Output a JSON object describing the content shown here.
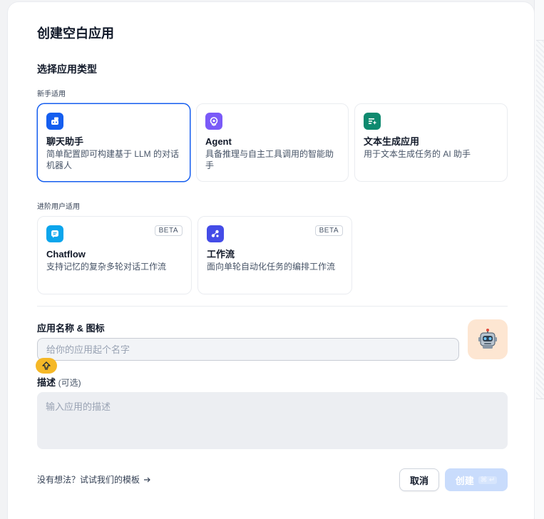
{
  "dialog": {
    "title": "创建空白应用",
    "section_title": "选择应用类型"
  },
  "groups": {
    "beginner_label": "新手适用",
    "advanced_label": "进阶用户适用"
  },
  "app_types": {
    "beginner": [
      {
        "name": "聊天助手",
        "desc": "简单配置即可构建基于 LLM 的对话机器人",
        "icon": "chat-bot-icon",
        "color": "#155eef",
        "selected": true
      },
      {
        "name": "Agent",
        "desc": "具备推理与自主工具调用的智能助手",
        "icon": "agent-icon",
        "color": "#7a5af8",
        "selected": false
      },
      {
        "name": "文本生成应用",
        "desc": "用于文本生成任务的 AI 助手",
        "icon": "text-generation-icon",
        "color": "#0e8a6f",
        "selected": false
      }
    ],
    "advanced": [
      {
        "name": "Chatflow",
        "desc": "支持记忆的复杂多轮对话工作流",
        "icon": "chatflow-icon",
        "color": "#0ba5ec",
        "badge": "BETA"
      },
      {
        "name": "工作流",
        "desc": "面向单轮自动化任务的编排工作流",
        "icon": "workflow-icon",
        "color": "#444ce7",
        "badge": "BETA"
      }
    ]
  },
  "form": {
    "name_label": "应用名称 & 图标",
    "name_placeholder": "给你的应用起个名字",
    "app_icon": "robot-emoji-icon",
    "app_icon_bg": "#fde6d2",
    "desc_label": "描述",
    "desc_optional": "(可选)",
    "desc_placeholder": "输入应用的描述"
  },
  "footer": {
    "template_link": "没有想法？试试我们的模板",
    "cancel_label": "取消",
    "create_label": "创建",
    "create_shortcut": "⌘ ↵"
  }
}
